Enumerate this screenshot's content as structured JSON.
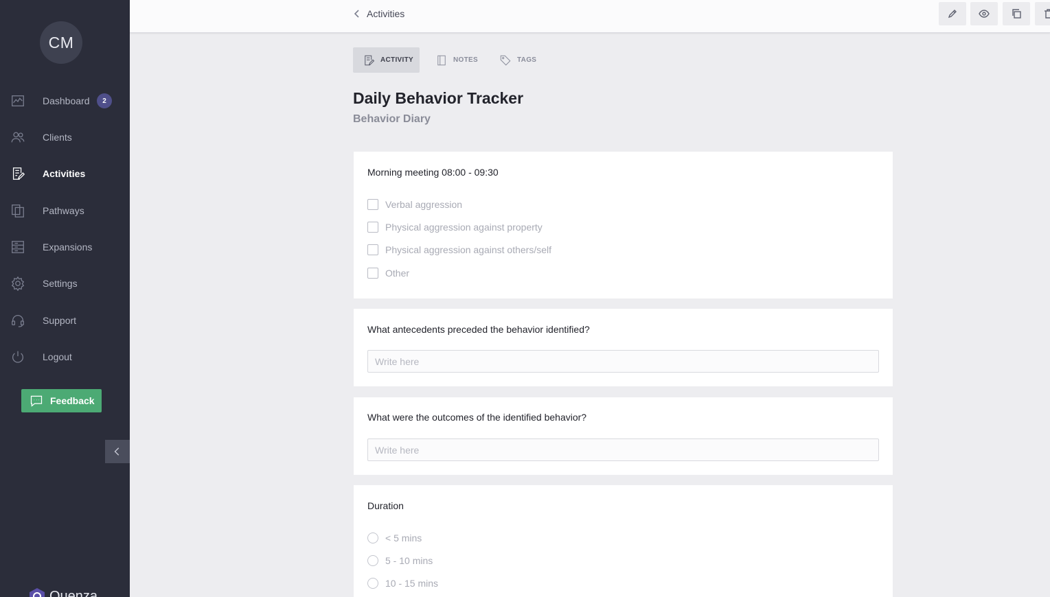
{
  "user": {
    "initials": "CM"
  },
  "sidebar": {
    "items": [
      {
        "label": "Dashboard",
        "icon": "dashboard-chart-icon",
        "badge": "2"
      },
      {
        "label": "Clients",
        "icon": "users-icon"
      },
      {
        "label": "Activities",
        "icon": "activities-icon",
        "active": true
      },
      {
        "label": "Pathways",
        "icon": "pathways-icon"
      },
      {
        "label": "Expansions",
        "icon": "expansions-icon"
      },
      {
        "label": "Settings",
        "icon": "gear-icon"
      },
      {
        "label": "Support",
        "icon": "headset-icon"
      },
      {
        "label": "Logout",
        "icon": "power-icon"
      }
    ],
    "feedback_label": "Feedback",
    "brand": "Quenza"
  },
  "header": {
    "back_label": "Activities",
    "tools": [
      "pencil-icon",
      "eye-icon",
      "copy-icon",
      "trash-icon"
    ]
  },
  "tabs": [
    {
      "label": "ACTIVITY",
      "active": true
    },
    {
      "label": "NOTES"
    },
    {
      "label": "TAGS"
    }
  ],
  "activity": {
    "title": "Daily Behavior Tracker",
    "subtitle": "Behavior Diary"
  },
  "questions": [
    {
      "label": "Morning meeting 08:00 - 09:30",
      "type": "checkbox",
      "options": [
        "Verbal aggression",
        "Physical aggression against property",
        "Physical aggression against others/self",
        "Other"
      ]
    },
    {
      "label": "What antecedents preceded the behavior identified?",
      "type": "text",
      "placeholder": "Write here"
    },
    {
      "label": "What were the outcomes of the identified behavior?",
      "type": "text",
      "placeholder": "Write here"
    },
    {
      "label": "Duration",
      "type": "radio",
      "options": [
        "< 5 mins",
        "5 - 10 mins",
        "10 - 15 mins"
      ]
    }
  ],
  "colors": {
    "sidebar": "#2b2d3a",
    "badge": "#4f4f8a",
    "feedback": "#4caa74",
    "background": "#ededf0"
  }
}
